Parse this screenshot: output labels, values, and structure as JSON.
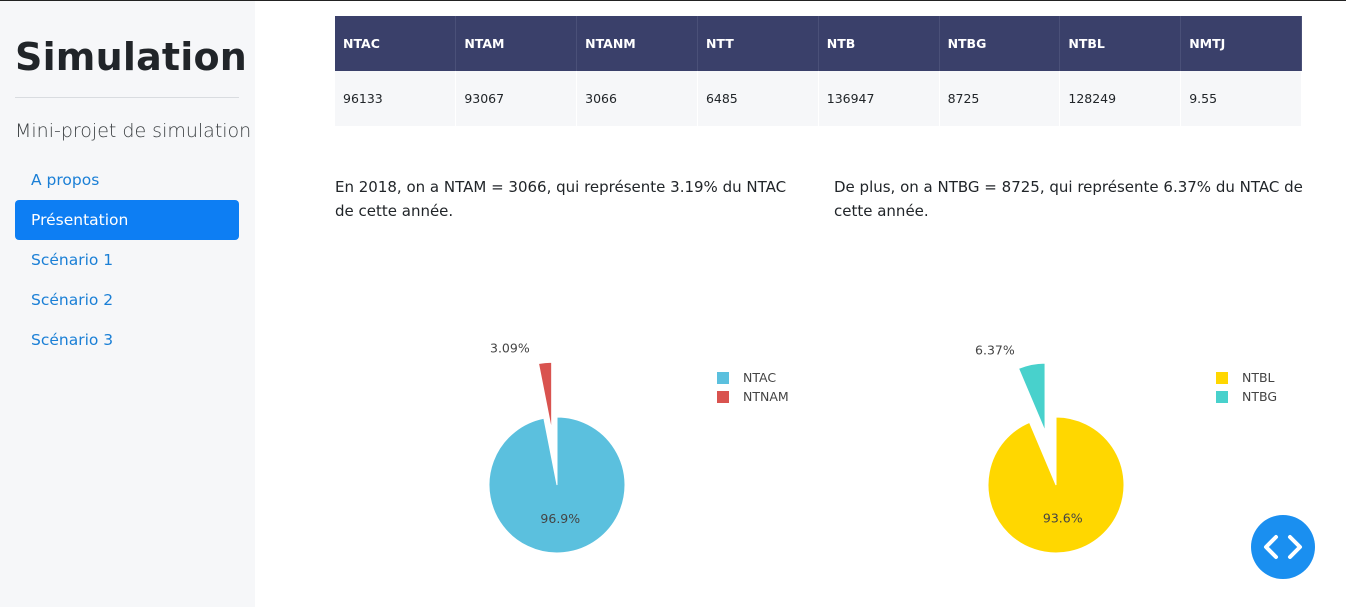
{
  "sidebar": {
    "title": "Simulation",
    "subtitle": "Mini-projet de simulation",
    "items": [
      {
        "label": "A propos",
        "active": false
      },
      {
        "label": "Présentation",
        "active": true
      },
      {
        "label": "Scénario 1",
        "active": false
      },
      {
        "label": "Scénario 2",
        "active": false
      },
      {
        "label": "Scénario 3",
        "active": false
      }
    ]
  },
  "table": {
    "headers": [
      "NTAC",
      "NTAM",
      "NTANM",
      "NTT",
      "NTB",
      "NTBG",
      "NTBL",
      "NMTJ"
    ],
    "row": [
      "96133",
      "93067",
      "3066",
      "6485",
      "136947",
      "8725",
      "128249",
      "9.55"
    ]
  },
  "text": {
    "left": "En 2018, on a NTAM = 3066, qui représente 3.19% du NTAC de cette année.",
    "right": "De plus, on a NTBG = 8725, qui représente 6.37% du NTAC de cette année."
  },
  "chart_data": [
    {
      "type": "pie",
      "labels": [
        "NTAC",
        "NTNAM"
      ],
      "values": [
        96.9,
        3.09
      ],
      "value_labels": [
        "96.9%",
        "3.09%"
      ],
      "colors": [
        "#5bc0de",
        "#d9534f"
      ],
      "pulled": [
        false,
        true
      ],
      "legend": "right"
    },
    {
      "type": "pie",
      "labels": [
        "NTBL",
        "NTBG"
      ],
      "values": [
        93.6,
        6.37
      ],
      "value_labels": [
        "93.6%",
        "6.37%"
      ],
      "colors": [
        "#ffd700",
        "#48d1cc"
      ],
      "pulled": [
        false,
        true
      ],
      "legend": "right"
    }
  ],
  "icons": {
    "fab": "code-icon"
  }
}
